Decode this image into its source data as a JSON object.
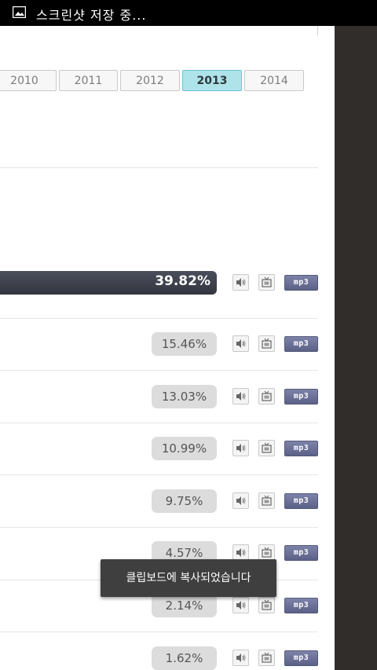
{
  "status_bar": {
    "icon": "image-icon",
    "text": "스크린샷 저장 중..."
  },
  "year_tabs": [
    "2010",
    "2011",
    "2012",
    "2013",
    "2014"
  ],
  "active_year": "2013",
  "rows": [
    {
      "percent": "39.82%",
      "highlighted": true
    },
    {
      "percent": "15.46%"
    },
    {
      "percent": "13.03%"
    },
    {
      "percent": "10.99%"
    },
    {
      "percent": "9.75%"
    },
    {
      "percent": "4.57%"
    },
    {
      "percent": "2.14%"
    },
    {
      "percent": "1.62%"
    }
  ],
  "row_buttons": {
    "speaker_icon": "speaker-icon",
    "tv_icon": "tv-icon",
    "mp3_label": "mp3"
  },
  "toast": {
    "text": "클립보드에 복사되었습니다"
  },
  "colors": {
    "active_tab": "#aee3ea",
    "highlight_bar": "#3b3f4c",
    "mp3_button": "#6b7096",
    "toast_bg": "#3f3f3f",
    "right_panel": "#312d2b"
  }
}
